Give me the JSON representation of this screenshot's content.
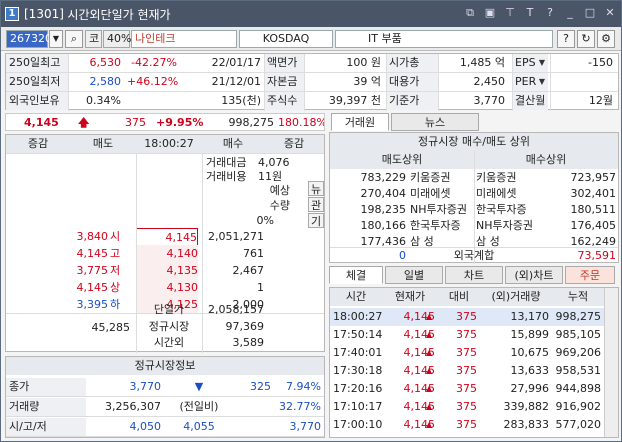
{
  "window": {
    "code": "[1301]",
    "title": "시간외단일가 현재가",
    "badge": "1"
  },
  "toolbar": {
    "code": "267320",
    "kospi_label": "코",
    "pct": "40%",
    "name": "나인테크",
    "market": "KOSDAQ",
    "sector": "IT 부품",
    "help": "?"
  },
  "info": {
    "rows": [
      [
        "250일최고",
        "6,530",
        "-42.27%",
        "22/01/17",
        "액면가",
        "100 원",
        "시가총",
        "1,485 억",
        "EPS",
        "-150"
      ],
      [
        "250일최저",
        "2,580",
        "+46.12%",
        "21/12/01",
        "자본금",
        "39 억",
        "대용가",
        "2,450",
        "PER",
        ""
      ],
      [
        "외국인보유",
        "0.34%",
        "",
        "135(천)",
        "주식수",
        "39,397 천",
        "기준가",
        "3,770",
        "결산월",
        "12월"
      ]
    ]
  },
  "quote": {
    "price": "4,145",
    "change": "375",
    "rate": "+9.95%",
    "volume": "998,275",
    "vol_rate": "180.18%"
  },
  "orderbook": {
    "headers": [
      "증감",
      "매도",
      "18:00:27",
      "매수",
      "증감"
    ],
    "amount_label": "거래대금",
    "amount": "4,076",
    "cost_label": "거래비용",
    "cost": "11원",
    "expect_label": "예상",
    "qty_label": "수량",
    "zero": "0%",
    "side": [
      "뉴",
      "관",
      "기"
    ],
    "sell": [
      {
        "tag": "시",
        "v": "3,840",
        "price": "4,145",
        "vol": "2,051,271"
      },
      {
        "tag": "고",
        "v": "4,145",
        "price": "4,140",
        "vol": "761"
      },
      {
        "tag": "저",
        "v": "3,775",
        "price": "4,135",
        "vol": "2,467"
      },
      {
        "tag": "상",
        "v": "4,145",
        "price": "4,130",
        "vol": "1"
      },
      {
        "tag": "하",
        "v": "3,395",
        "price": "4,125",
        "vol": "2,000"
      }
    ],
    "sum_sell": "45,285",
    "single_label": "단일가",
    "single": "2,058,157",
    "reg_label": "정규시장",
    "reg": "97,369",
    "after_label": "시간외",
    "after": "3,589"
  },
  "regular": {
    "title": "정규시장정보",
    "rows": [
      [
        "종가",
        "3,770",
        "▼",
        "325",
        "7.94%"
      ],
      [
        "거래량",
        "3,256,307",
        "(전일비)",
        "",
        "32.77%"
      ],
      [
        "시/고/저",
        "4,050",
        "4,055",
        "",
        "3,770"
      ]
    ]
  },
  "rtabs": [
    "거래원",
    "뉴스"
  ],
  "broker": {
    "title": "정규시장 매수/매도 상위",
    "sell_h": "매도상위",
    "buy_h": "매수상위",
    "rows": [
      [
        "783,229",
        "키움증권",
        "키움증권",
        "723,957"
      ],
      [
        "270,404",
        "미래에셋",
        "미래에셋",
        "302,401"
      ],
      [
        "198,235",
        "NH투자증권",
        "한국투자증",
        "180,511"
      ],
      [
        "180,166",
        "한국투자증",
        "NH투자증권",
        "176,405"
      ],
      [
        "177,436",
        "삼 성",
        "삼 성",
        "162,249"
      ]
    ],
    "foreign_l": "0",
    "foreign_label": "외국계합",
    "foreign_r": "73,591"
  },
  "btabs": [
    "체결",
    "일별",
    "차트",
    "(외)차트",
    "주문"
  ],
  "trades": {
    "headers": [
      "시간",
      "현재가",
      "대비",
      "(외)거래량",
      "누적"
    ],
    "rows": [
      [
        "18:00:27",
        "4,145",
        "375",
        "13,170",
        "998,275"
      ],
      [
        "17:50:14",
        "4,145",
        "375",
        "15,899",
        "985,105"
      ],
      [
        "17:40:01",
        "4,145",
        "375",
        "10,675",
        "969,206"
      ],
      [
        "17:30:18",
        "4,145",
        "375",
        "13,633",
        "958,531"
      ],
      [
        "17:20:16",
        "4,145",
        "375",
        "27,996",
        "944,898"
      ],
      [
        "17:10:17",
        "4,145",
        "375",
        "339,882",
        "916,902"
      ],
      [
        "17:00:10",
        "4,145",
        "375",
        "283,833",
        "577,020"
      ]
    ]
  }
}
